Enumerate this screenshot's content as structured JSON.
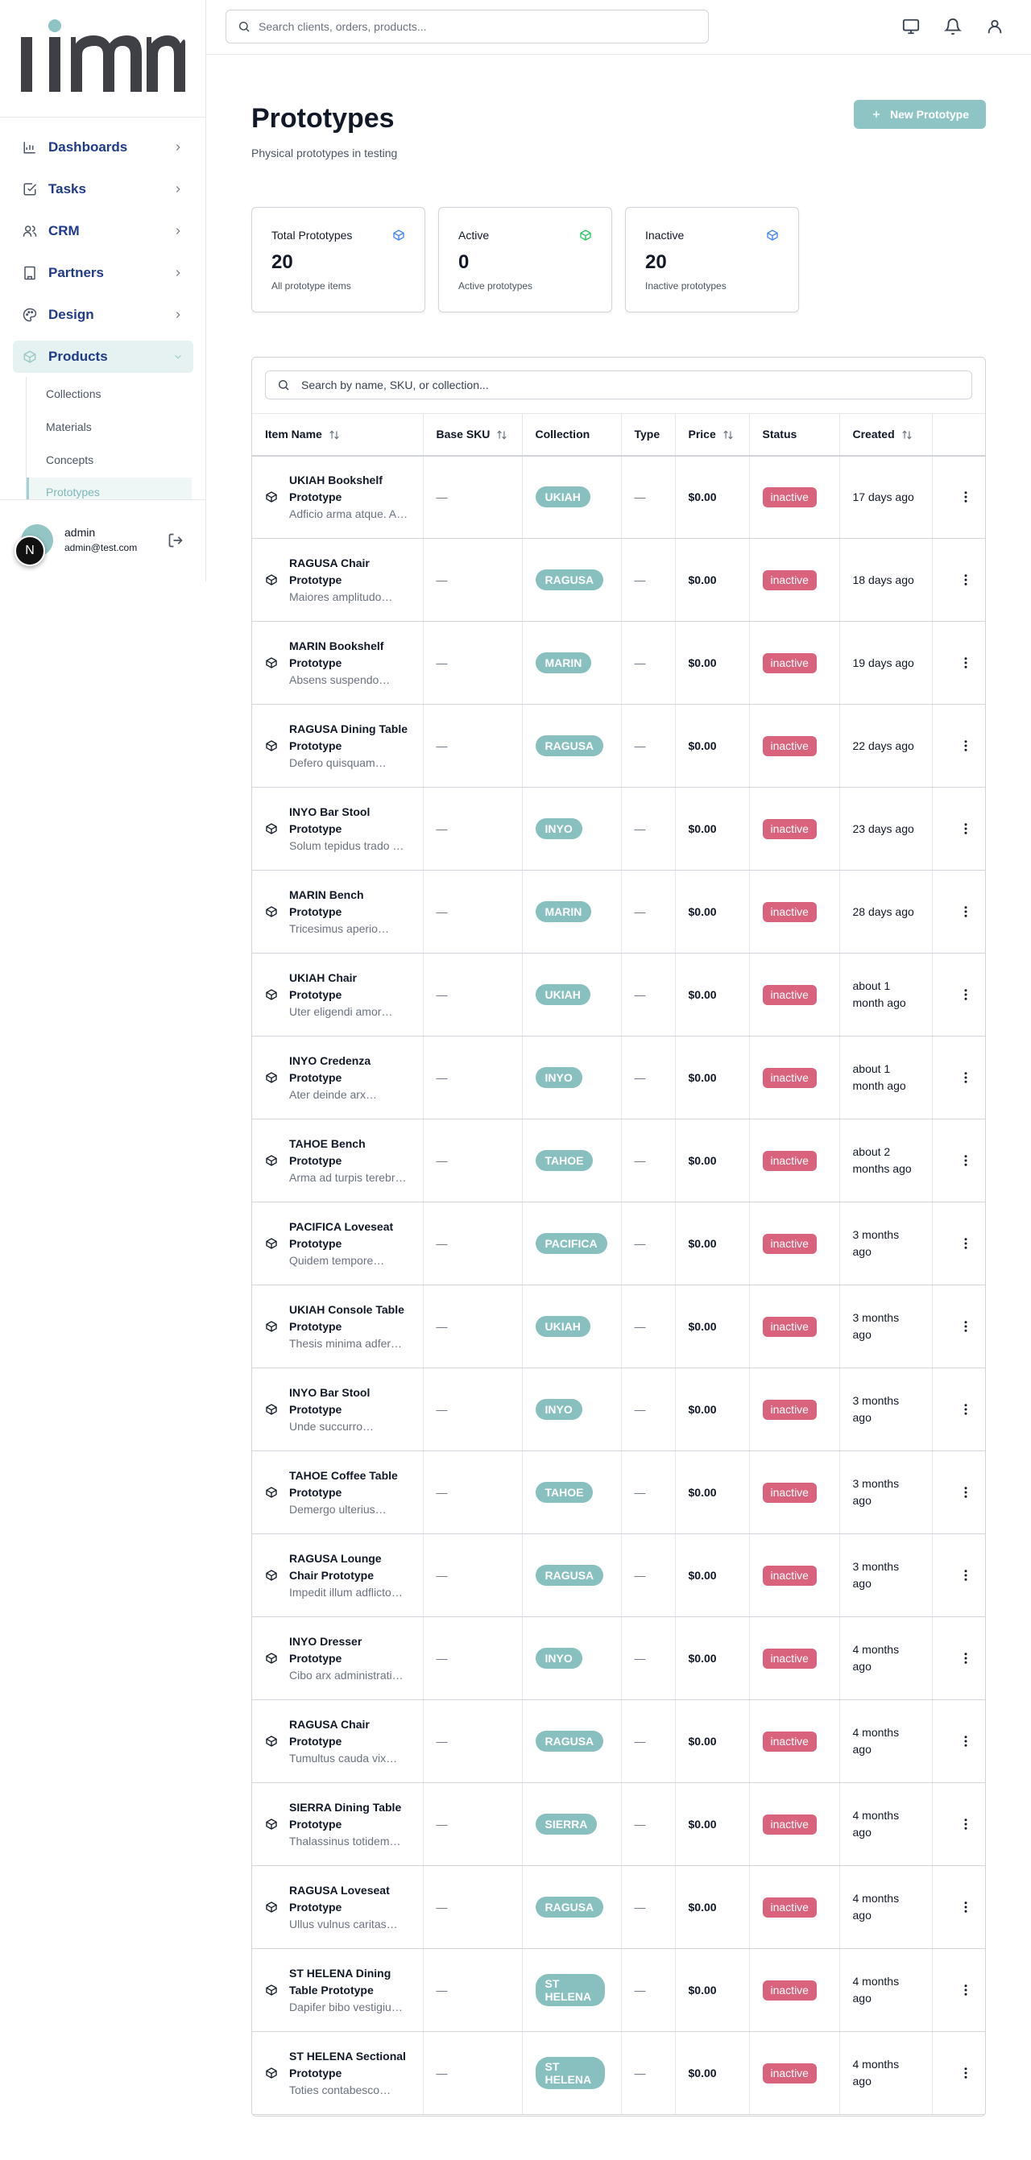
{
  "brand": {
    "logo_text": "lim",
    "accent": "#8fc4c4"
  },
  "search": {
    "placeholder": "Search clients, orders, products..."
  },
  "sidebar": {
    "items": [
      {
        "label": "Dashboards",
        "icon": "bar-chart-icon"
      },
      {
        "label": "Tasks",
        "icon": "check-square-icon"
      },
      {
        "label": "CRM",
        "icon": "users-icon"
      },
      {
        "label": "Partners",
        "icon": "building-icon"
      },
      {
        "label": "Design",
        "icon": "palette-icon"
      },
      {
        "label": "Products",
        "icon": "package-icon",
        "active": true
      }
    ],
    "subitems": [
      {
        "label": "Collections"
      },
      {
        "label": "Materials"
      },
      {
        "label": "Concepts"
      },
      {
        "label": "Prototypes",
        "active": true
      }
    ]
  },
  "user": {
    "name": "admin",
    "email": "admin@test.com",
    "badge": "N"
  },
  "page": {
    "title": "Prototypes",
    "subtitle": "Physical prototypes in testing",
    "new_button": "New Prototype"
  },
  "stats": [
    {
      "title": "Total Prototypes",
      "value": "20",
      "desc": "All prototype items",
      "icon_color": "#3b82f6"
    },
    {
      "title": "Active",
      "value": "0",
      "desc": "Active prototypes",
      "icon_color": "#22c55e"
    },
    {
      "title": "Inactive",
      "value": "20",
      "desc": "Inactive prototypes",
      "icon_color": "#3b82f6"
    }
  ],
  "table": {
    "search_placeholder": "Search by name, SKU, or collection...",
    "headers": {
      "item_name": "Item Name",
      "base_sku": "Base SKU",
      "collection": "Collection",
      "type": "Type",
      "price": "Price",
      "status": "Status",
      "created": "Created"
    },
    "rows": [
      {
        "name": "UKIAH Bookshelf Prototype",
        "desc": "Adficio arma atque. Abs…",
        "sku": "—",
        "collection": "UKIAH",
        "type": "—",
        "price": "$0.00",
        "status": "inactive",
        "created": "17 days ago"
      },
      {
        "name": "RAGUSA Chair Prototype",
        "desc": "Maiores amplitudo…",
        "sku": "—",
        "collection": "RAGUSA",
        "type": "—",
        "price": "$0.00",
        "status": "inactive",
        "created": "18 days ago"
      },
      {
        "name": "MARIN Bookshelf Prototype",
        "desc": "Absens suspendo…",
        "sku": "—",
        "collection": "MARIN",
        "type": "—",
        "price": "$0.00",
        "status": "inactive",
        "created": "19 days ago"
      },
      {
        "name": "RAGUSA Dining Table Prototype",
        "desc": "Defero quisquam…",
        "sku": "—",
        "collection": "RAGUSA",
        "type": "—",
        "price": "$0.00",
        "status": "inactive",
        "created": "22 days ago"
      },
      {
        "name": "INYO Bar Stool Prototype",
        "desc": "Solum tepidus trado …",
        "sku": "—",
        "collection": "INYO",
        "type": "—",
        "price": "$0.00",
        "status": "inactive",
        "created": "23 days ago"
      },
      {
        "name": "MARIN Bench Prototype",
        "desc": "Tricesimus aperio…",
        "sku": "—",
        "collection": "MARIN",
        "type": "—",
        "price": "$0.00",
        "status": "inactive",
        "created": "28 days ago"
      },
      {
        "name": "UKIAH Chair Prototype",
        "desc": "Uter eligendi amor…",
        "sku": "—",
        "collection": "UKIAH",
        "type": "—",
        "price": "$0.00",
        "status": "inactive",
        "created": "about 1 month ago"
      },
      {
        "name": "INYO Credenza Prototype",
        "desc": "Ater deinde arx…",
        "sku": "—",
        "collection": "INYO",
        "type": "—",
        "price": "$0.00",
        "status": "inactive",
        "created": "about 1 month ago"
      },
      {
        "name": "TAHOE Bench Prototype",
        "desc": "Arma ad turpis terebr…",
        "sku": "—",
        "collection": "TAHOE",
        "type": "—",
        "price": "$0.00",
        "status": "inactive",
        "created": "about 2 months ago"
      },
      {
        "name": "PACIFICA Loveseat Prototype",
        "desc": "Quidem tempore…",
        "sku": "—",
        "collection": "PACIFICA",
        "type": "—",
        "price": "$0.00",
        "status": "inactive",
        "created": "3 months ago"
      },
      {
        "name": "UKIAH Console Table Prototype",
        "desc": "Thesis minima adfer…",
        "sku": "—",
        "collection": "UKIAH",
        "type": "—",
        "price": "$0.00",
        "status": "inactive",
        "created": "3 months ago"
      },
      {
        "name": "INYO Bar Stool Prototype",
        "desc": "Unde succurro…",
        "sku": "—",
        "collection": "INYO",
        "type": "—",
        "price": "$0.00",
        "status": "inactive",
        "created": "3 months ago"
      },
      {
        "name": "TAHOE Coffee Table Prototype",
        "desc": "Demergo ulterius…",
        "sku": "—",
        "collection": "TAHOE",
        "type": "—",
        "price": "$0.00",
        "status": "inactive",
        "created": "3 months ago"
      },
      {
        "name": "RAGUSA Lounge Chair Prototype",
        "desc": "Impedit illum adflicto…",
        "sku": "—",
        "collection": "RAGUSA",
        "type": "—",
        "price": "$0.00",
        "status": "inactive",
        "created": "3 months ago"
      },
      {
        "name": "INYO Dresser Prototype",
        "desc": "Cibo arx administrati…",
        "sku": "—",
        "collection": "INYO",
        "type": "—",
        "price": "$0.00",
        "status": "inactive",
        "created": "4 months ago"
      },
      {
        "name": "RAGUSA Chair Prototype",
        "desc": "Tumultus cauda vix…",
        "sku": "—",
        "collection": "RAGUSA",
        "type": "—",
        "price": "$0.00",
        "status": "inactive",
        "created": "4 months ago"
      },
      {
        "name": "SIERRA Dining Table Prototype",
        "desc": "Thalassinus totidem…",
        "sku": "—",
        "collection": "SIERRA",
        "type": "—",
        "price": "$0.00",
        "status": "inactive",
        "created": "4 months ago"
      },
      {
        "name": "RAGUSA Loveseat Prototype",
        "desc": "Ullus vulnus caritas…",
        "sku": "—",
        "collection": "RAGUSA",
        "type": "—",
        "price": "$0.00",
        "status": "inactive",
        "created": "4 months ago"
      },
      {
        "name": "ST HELENA Dining Table Prototype",
        "desc": "Dapifer bibo vestigiu…",
        "sku": "—",
        "collection": "ST HELENA",
        "type": "—",
        "price": "$0.00",
        "status": "inactive",
        "created": "4 months ago"
      },
      {
        "name": "ST HELENA Sectional Prototype",
        "desc": "Toties contabesco…",
        "sku": "—",
        "collection": "ST HELENA",
        "type": "—",
        "price": "$0.00",
        "status": "inactive",
        "created": "4 months ago"
      }
    ]
  }
}
